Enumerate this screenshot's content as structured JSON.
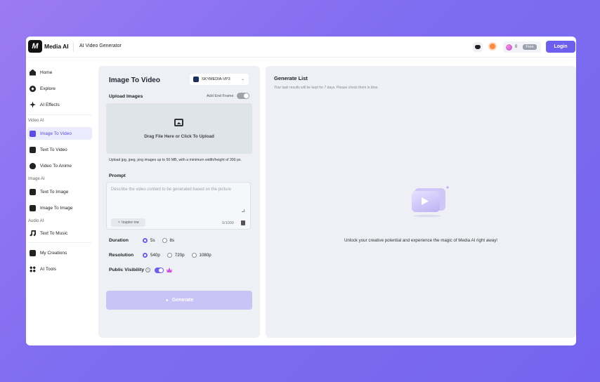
{
  "app": {
    "brand": "Media AI",
    "logo_text": "M",
    "subtitle": "AI Video Generator",
    "credits": "0",
    "plan_badge": "Free",
    "login_label": "Login",
    "accent_color": "#6c5ff0"
  },
  "sidebar": {
    "items": [
      {
        "label": "Home"
      },
      {
        "label": "Explore"
      },
      {
        "label": "AI Effects"
      },
      {
        "label": "Image To Video"
      },
      {
        "label": "Text To Video"
      },
      {
        "label": "Video To Anime"
      },
      {
        "label": "Text To Image"
      },
      {
        "label": "Image To Image"
      },
      {
        "label": "Text To Music"
      },
      {
        "label": "My Creations"
      },
      {
        "label": "AI Tools"
      }
    ],
    "sections": {
      "video": "Video AI",
      "image": "Image AI",
      "audio": "Audio AI"
    },
    "active_item": "Image To Video"
  },
  "form": {
    "title": "Image To Video",
    "model": "SKYMEDIA-VP3",
    "upload_label": "Upload Images",
    "add_end_frame": "Add End Frame",
    "dropzone_text": "Drag File Here or Click To Upload",
    "upload_hint": "Upload jpg, jpeg, png images up to 50 MB, with a minimum width/height of 300 px.",
    "prompt_label": "Prompt",
    "prompt_placeholder": "Describe the video content to be generated based on the picture",
    "inspire_label": "Inspire me",
    "char_count": "0/1000",
    "duration_label": "Duration",
    "duration_options": [
      "5s",
      "8s"
    ],
    "duration_selected": "5s",
    "resolution_label": "Resolution",
    "resolution_options": [
      "540p",
      "720p",
      "1080p"
    ],
    "resolution_selected": "540p",
    "visibility_label": "Public Visibility",
    "generate_label": "Generate"
  },
  "results": {
    "title": "Generate List",
    "note": "Your task results will be kept for 7 days. Please check them in time.",
    "empty_message": "Unlock your creative potential and experience the magic of Media AI right away!"
  }
}
